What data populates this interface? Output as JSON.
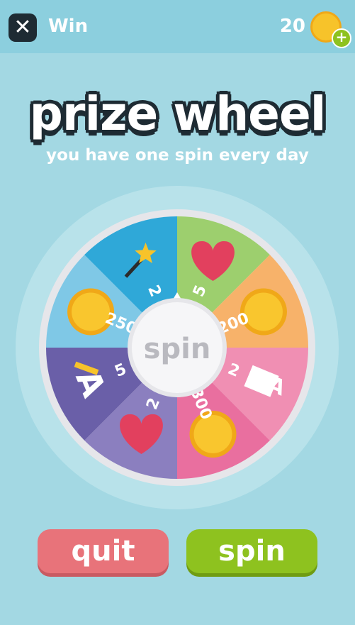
{
  "topbar": {
    "close_icon": "close-icon",
    "title": "Win",
    "coins": "20",
    "coin_icon": "coin-icon",
    "add_icon": "plus-icon"
  },
  "header": {
    "title": "prize wheel",
    "subtitle": "you have one spin every day"
  },
  "wheel": {
    "center_label": "spin",
    "segments": [
      {
        "prize": "heart",
        "amount": "5",
        "color": "#9dcf6e"
      },
      {
        "prize": "coin",
        "amount": "200",
        "color": "#f7b26a"
      },
      {
        "prize": "notepad",
        "amount": "2",
        "color": "#f08fb3"
      },
      {
        "prize": "coin",
        "amount": "300",
        "color": "#e96f9f"
      },
      {
        "prize": "heart",
        "amount": "2",
        "color": "#8b7fbf"
      },
      {
        "prize": "pencil",
        "amount": "5",
        "color": "#6a5fa8"
      },
      {
        "prize": "coin",
        "amount": "250",
        "color": "#7fc8e6"
      },
      {
        "prize": "magic-wand",
        "amount": "2",
        "color": "#2fa8d8"
      }
    ]
  },
  "buttons": {
    "quit": "quit",
    "spin": "spin"
  },
  "colors": {
    "background": "#a3d8e3",
    "topbar": "#8ccfde",
    "quit": "#e8737a",
    "spin": "#8ec21f"
  }
}
